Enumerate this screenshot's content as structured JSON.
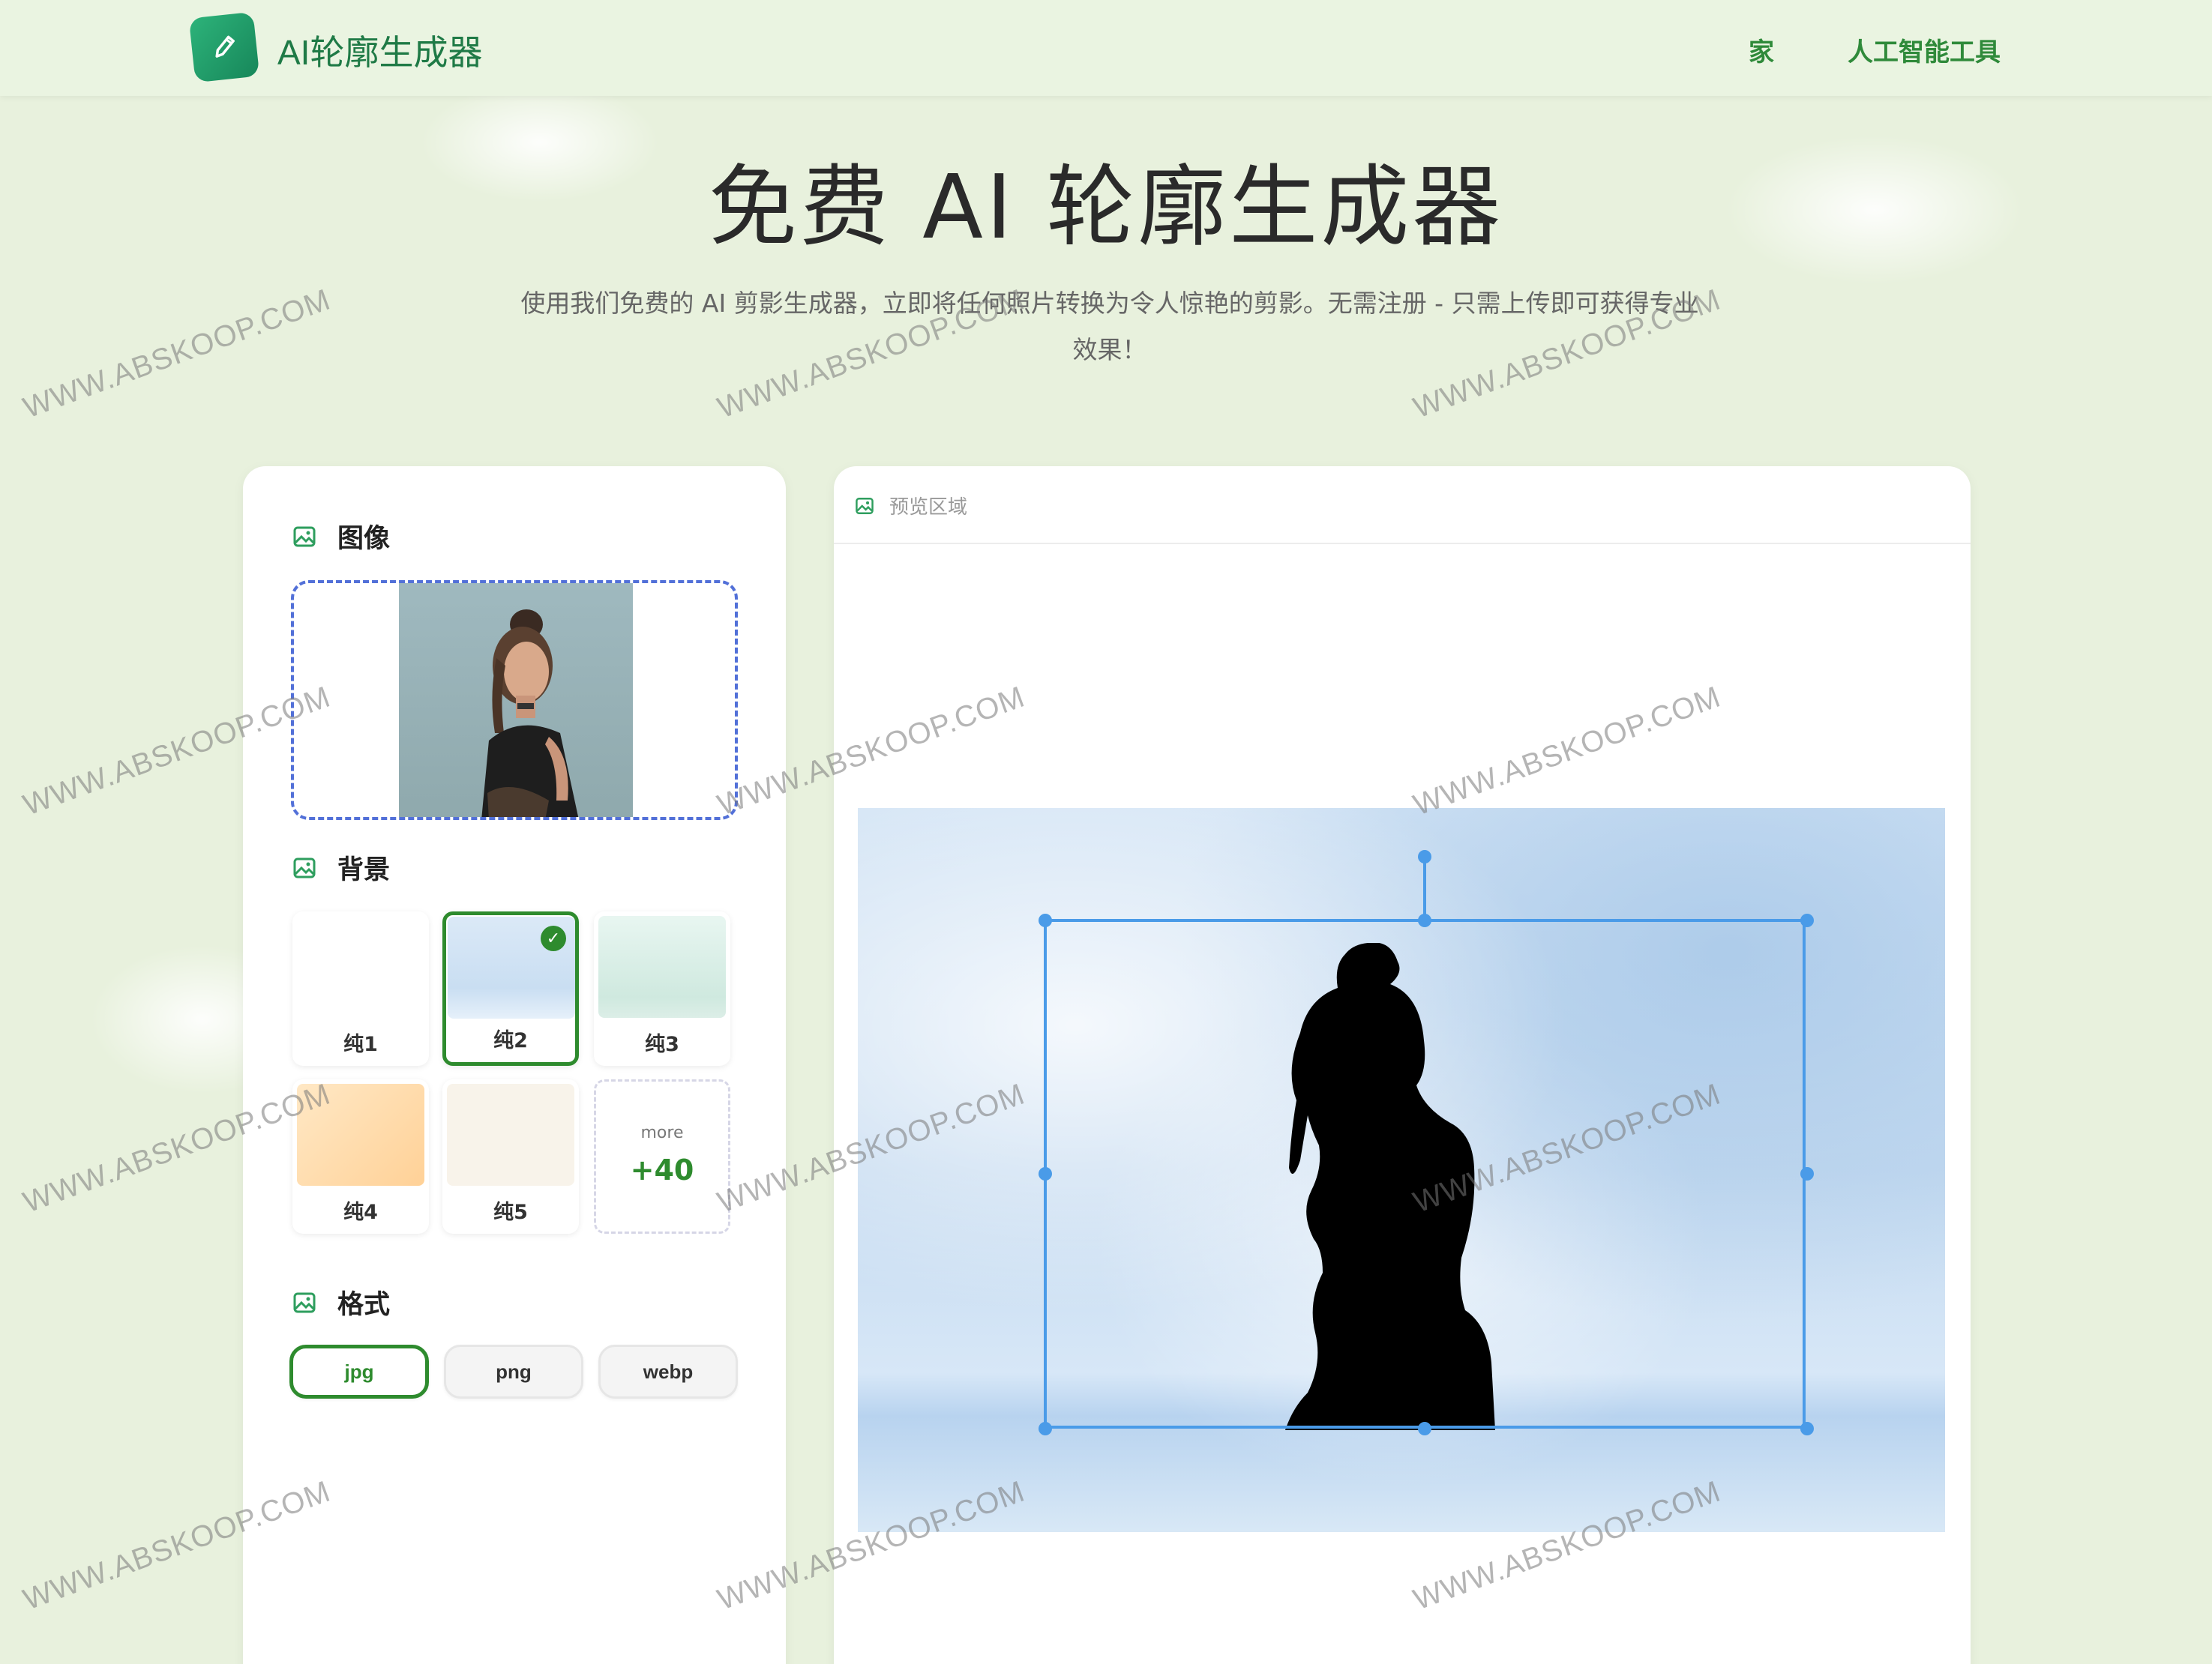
{
  "header": {
    "logo_title": "AI轮廓生成器",
    "nav": [
      {
        "label": "家"
      },
      {
        "label": "人工智能工具"
      }
    ]
  },
  "hero": {
    "title": "免费 AI 轮廓生成器",
    "subtitle": "使用我们免费的 AI 剪影生成器，立即将任何照片转换为令人惊艳的剪影。无需注册 - 只需上传即可获得专业效果！"
  },
  "left_panel": {
    "image_section": {
      "title": "图像",
      "icon": "image-icon"
    },
    "background_section": {
      "title": "背景",
      "icon": "image-icon",
      "options": [
        {
          "label": "纯1",
          "color": "#ffffff",
          "selected": false
        },
        {
          "label": "纯2",
          "color": "#cfe2f5",
          "selected": true
        },
        {
          "label": "纯3",
          "color": "#dff0ea",
          "selected": false
        },
        {
          "label": "纯4",
          "color": "#ffd9a8",
          "selected": false
        },
        {
          "label": "纯5",
          "color": "#f8f3ea",
          "selected": false
        }
      ],
      "more": {
        "label": "more",
        "count": "+40"
      }
    },
    "format_section": {
      "title": "格式",
      "icon": "image-icon",
      "options": [
        {
          "label": "jpg",
          "active": true
        },
        {
          "label": "png",
          "active": false
        },
        {
          "label": "webp",
          "active": false
        }
      ]
    }
  },
  "right_panel": {
    "title": "预览区域",
    "icon": "image-icon"
  },
  "watermark": "WWW.ABSKOOP.COM",
  "colors": {
    "accent": "#2e8b2e",
    "selection": "#4a9be8",
    "page_bg": "#e8f1dd"
  }
}
